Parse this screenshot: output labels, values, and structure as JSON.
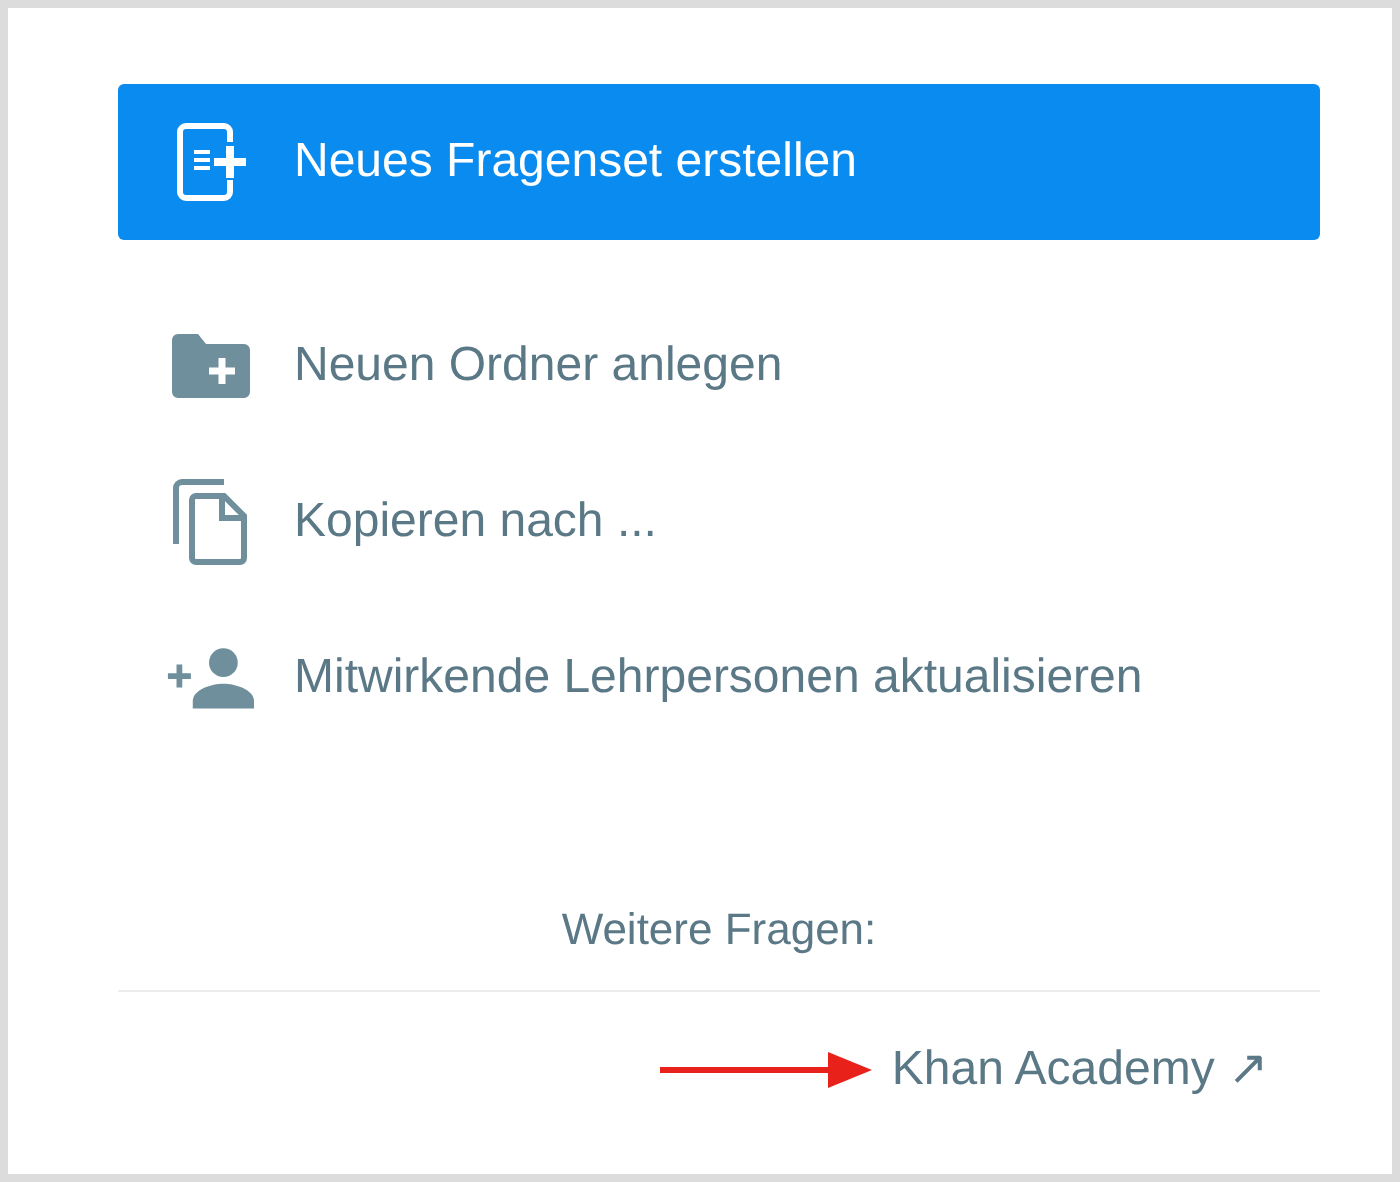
{
  "primary_action": {
    "label": "Neues Fragenset erstellen"
  },
  "menu_items": [
    {
      "label": "Neuen Ordner anlegen"
    },
    {
      "label": "Kopieren nach ..."
    },
    {
      "label": "Mitwirkende Lehrpersonen aktualisieren"
    }
  ],
  "more_questions": {
    "heading": "Weitere Fragen:",
    "link": {
      "label": "Khan Academy",
      "external_mark": "↗"
    }
  }
}
